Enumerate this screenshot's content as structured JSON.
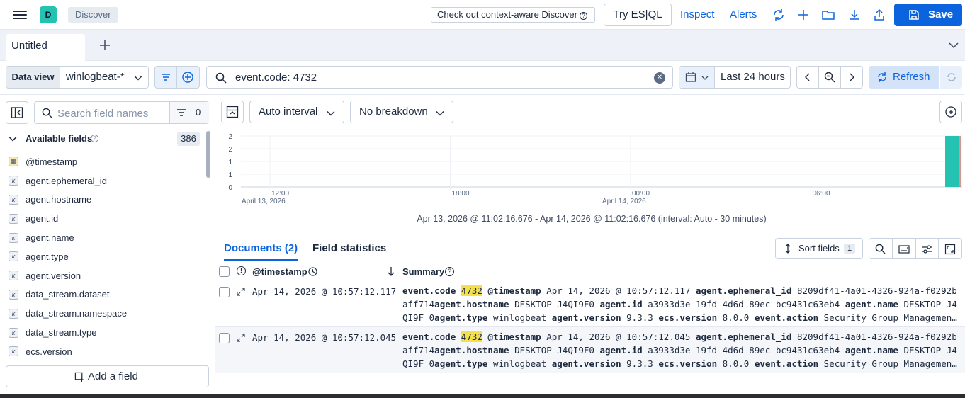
{
  "header": {
    "space_initial": "D",
    "breadcrumb": "Discover",
    "context_aware_label": "Check out context-aware Discover",
    "try_esql_label": "Try ES|QL",
    "inspect_label": "Inspect",
    "alerts_label": "Alerts",
    "save_label": "Save"
  },
  "tabs": {
    "active_tab": "Untitled"
  },
  "query": {
    "data_view_label": "Data view",
    "data_view_value": "winlogbeat-*",
    "query_text": "event.code: 4732",
    "time_range": "Last 24 hours",
    "refresh_label": "Refresh"
  },
  "sidebar": {
    "search_placeholder": "Search field names",
    "filter_count": "0",
    "available_label": "Available fields",
    "available_count": "386",
    "fields": [
      {
        "name": "@timestamp",
        "type": "date"
      },
      {
        "name": "agent.ephemeral_id",
        "type": "keyword"
      },
      {
        "name": "agent.hostname",
        "type": "keyword"
      },
      {
        "name": "agent.id",
        "type": "keyword"
      },
      {
        "name": "agent.name",
        "type": "keyword"
      },
      {
        "name": "agent.type",
        "type": "keyword"
      },
      {
        "name": "agent.version",
        "type": "keyword"
      },
      {
        "name": "data_stream.dataset",
        "type": "keyword"
      },
      {
        "name": "data_stream.namespace",
        "type": "keyword"
      },
      {
        "name": "data_stream.type",
        "type": "keyword"
      },
      {
        "name": "ecs.version",
        "type": "keyword"
      }
    ],
    "add_field_label": "Add a field"
  },
  "chart_toolbar": {
    "interval_label": "Auto interval",
    "breakdown_label": "No breakdown"
  },
  "chart_data": {
    "type": "bar",
    "y_ticks": [
      "2",
      "2",
      "1",
      "1",
      "0"
    ],
    "x_ticks": [
      {
        "time": "12:00",
        "date": "April 13, 2026"
      },
      {
        "time": "18:00",
        "date": ""
      },
      {
        "time": "00:00",
        "date": "April 14, 2026"
      },
      {
        "time": "06:00",
        "date": ""
      }
    ],
    "bars": [
      {
        "x": "Apr 14, 2026 @ 10:30",
        "value": 2
      }
    ],
    "ylim": [
      0,
      2
    ],
    "bar_color": "#24c2b0"
  },
  "time_range_text": "Apr 13, 2026 @ 11:02:16.676 - Apr 14, 2026 @ 11:02:16.676 (interval: Auto - 30 minutes)",
  "doc_tabs": {
    "documents_label": "Documents (2)",
    "field_stats_label": "Field statistics",
    "sort_fields_label": "Sort fields",
    "sort_count": "1"
  },
  "grid": {
    "col_timestamp": "@timestamp",
    "col_summary": "Summary",
    "rows": [
      {
        "timestamp": "Apr 14, 2026 @ 10:57:12.117",
        "code_key": "event.code",
        "code_val": "4732",
        "rest_a_key": "@timestamp",
        "rest_a_val": "Apr 14, 2026 @ 10:57:12.117",
        "eph_key": "agent.ephemeral_id",
        "eph_val": "8209df41-4a01-4326-924a-f0292baff71",
        "line2": "4",
        "hostname_key": "agent.hostname",
        "hostname_val": "DESKTOP-J4QI9F0",
        "id_key": "agent.id",
        "id_val": "a3933d3e-19fd-4d6d-89ec-bc9431c63eb4",
        "name_key": "agent.name",
        "name_val": "DESKTOP-J4QI9F",
        "line3": "0",
        "type_key": "agent.type",
        "type_val": "winlogbeat",
        "version_key": "agent.version",
        "version_val": "9.3.3",
        "ecs_key": "ecs.version",
        "ecs_val": "8.0.0",
        "action_key": "event.action",
        "action_val": "Security Group Managemen…"
      },
      {
        "timestamp": "Apr 14, 2026 @ 10:57:12.045",
        "code_key": "event.code",
        "code_val": "4732",
        "rest_a_key": "@timestamp",
        "rest_a_val": "Apr 14, 2026 @ 10:57:12.045",
        "eph_key": "agent.ephemeral_id",
        "eph_val": "8209df41-4a01-4326-924a-f0292baff71",
        "line2": "4",
        "hostname_key": "agent.hostname",
        "hostname_val": "DESKTOP-J4QI9F0",
        "id_key": "agent.id",
        "id_val": "a3933d3e-19fd-4d6d-89ec-bc9431c63eb4",
        "name_key": "agent.name",
        "name_val": "DESKTOP-J4QI9F",
        "line3": "0",
        "type_key": "agent.type",
        "type_val": "winlogbeat",
        "version_key": "agent.version",
        "version_val": "9.3.3",
        "ecs_key": "ecs.version",
        "ecs_val": "8.0.0",
        "action_key": "event.action",
        "action_val": "Security Group Managemen…"
      }
    ]
  }
}
